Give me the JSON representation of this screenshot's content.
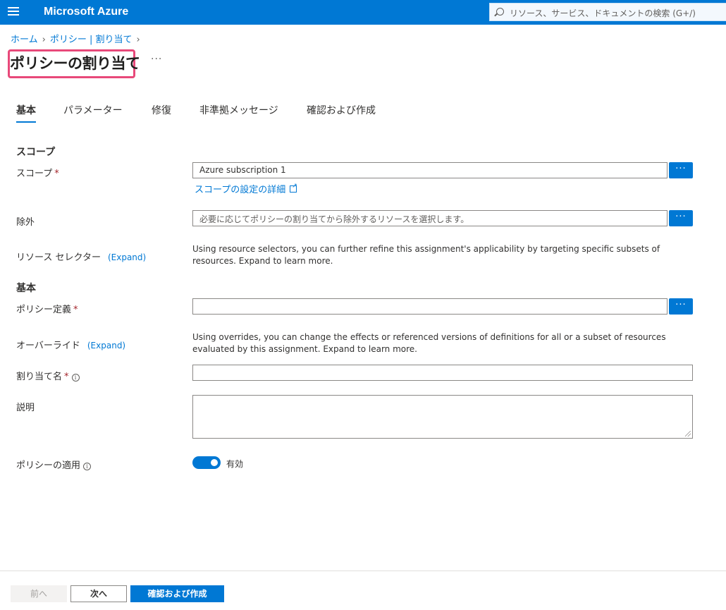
{
  "topbar": {
    "brand": "Microsoft Azure",
    "search_placeholder": "リソース、サービス、ドキュメントの検索 (G+/)"
  },
  "breadcrumb": {
    "items": [
      "ホーム",
      "ポリシー | 割り当て"
    ]
  },
  "page": {
    "title": "ポリシーの割り当て",
    "more": "···"
  },
  "tabs": [
    {
      "label": "基本"
    },
    {
      "label": "パラメーター"
    },
    {
      "label": "修復"
    },
    {
      "label": "非準拠メッセージ"
    },
    {
      "label": "確認および作成"
    }
  ],
  "scope_section": {
    "heading": "スコープ",
    "scope_label": "スコープ",
    "scope_value": "Azure subscription 1",
    "scope_link": "スコープの設定の詳細",
    "exclusions_label": "除外",
    "exclusions_placeholder": "必要に応じてポリシーの割り当てから除外するリソースを選択します。",
    "resource_selectors_label": "リソース セレクター",
    "resource_selectors_expand": "(Expand)",
    "resource_selectors_desc": "Using resource selectors, you can further refine this assignment's applicability by targeting specific subsets of resources. Expand to learn more."
  },
  "basics_section": {
    "heading": "基本",
    "policy_definition_label": "ポリシー定義",
    "policy_definition_value": "",
    "overrides_label": "オーバーライド",
    "overrides_expand": "(Expand)",
    "overrides_desc": "Using overrides, you can change the effects or referenced versions of definitions for all or a subset of resources evaluated by this assignment. Expand to learn more.",
    "assignment_name_label": "割り当て名",
    "assignment_name_value": "",
    "description_label": "説明",
    "description_value": "",
    "enforcement_label": "ポリシーの適用",
    "enforcement_value": "有効"
  },
  "common": {
    "required_mark": "*",
    "info_glyph": "i",
    "ellipsis": "···"
  },
  "footer": {
    "prev": "前へ",
    "next": "次へ",
    "review_create": "確認および作成"
  }
}
